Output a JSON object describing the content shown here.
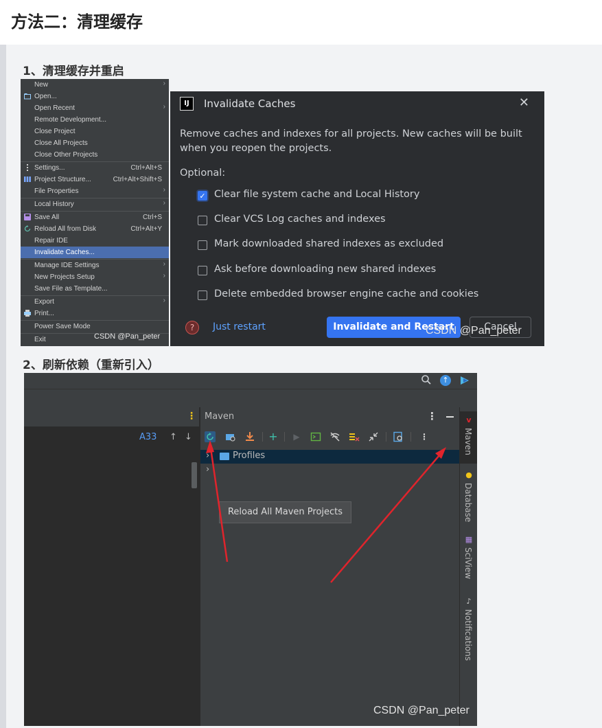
{
  "heading": "方法二：清理缓存",
  "steps": {
    "step1": "1、清理缓存并重启",
    "step2": "2、刷新依赖（重新引入）"
  },
  "file_menu": {
    "items": [
      {
        "label": "New",
        "shortcut": "",
        "submenu": true,
        "icon": ""
      },
      {
        "label": "Open...",
        "shortcut": "",
        "submenu": false,
        "icon": "folder-icon"
      },
      {
        "label": "Open Recent",
        "shortcut": "",
        "submenu": true,
        "icon": ""
      },
      {
        "label": "Remote Development...",
        "shortcut": "",
        "submenu": false,
        "icon": ""
      },
      {
        "label": "Close Project",
        "shortcut": "",
        "submenu": false,
        "icon": ""
      },
      {
        "label": "Close All Projects",
        "shortcut": "",
        "submenu": false,
        "icon": ""
      },
      {
        "label": "Close Other Projects",
        "shortcut": "",
        "submenu": false,
        "icon": ""
      },
      {
        "label": "Settings...",
        "shortcut": "Ctrl+Alt+S",
        "submenu": false,
        "icon": "settings-icon"
      },
      {
        "label": "Project Structure...",
        "shortcut": "Ctrl+Alt+Shift+S",
        "submenu": false,
        "icon": "project-structure-icon"
      },
      {
        "label": "File Properties",
        "shortcut": "",
        "submenu": true,
        "icon": ""
      },
      {
        "label": "Local History",
        "shortcut": "",
        "submenu": true,
        "icon": ""
      },
      {
        "label": "Save All",
        "shortcut": "Ctrl+S",
        "submenu": false,
        "icon": "save-icon"
      },
      {
        "label": "Reload All from Disk",
        "shortcut": "Ctrl+Alt+Y",
        "submenu": false,
        "icon": "reload-icon"
      },
      {
        "label": "Repair IDE",
        "shortcut": "",
        "submenu": false,
        "icon": ""
      },
      {
        "label": "Invalidate Caches...",
        "shortcut": "",
        "submenu": false,
        "icon": "",
        "selected": true
      },
      {
        "label": "Manage IDE Settings",
        "shortcut": "",
        "submenu": true,
        "icon": ""
      },
      {
        "label": "New Projects Setup",
        "shortcut": "",
        "submenu": true,
        "icon": ""
      },
      {
        "label": "Save File as Template...",
        "shortcut": "",
        "submenu": false,
        "icon": ""
      },
      {
        "label": "Export",
        "shortcut": "",
        "submenu": true,
        "icon": ""
      },
      {
        "label": "Print...",
        "shortcut": "",
        "submenu": false,
        "icon": "print-icon"
      },
      {
        "label": "Power Save Mode",
        "shortcut": "",
        "submenu": false,
        "icon": ""
      },
      {
        "label": "Exit",
        "shortcut": "",
        "submenu": false,
        "icon": ""
      }
    ]
  },
  "watermark": "CSDN @Pan_peter",
  "dialog": {
    "title": "Invalidate Caches",
    "logo": "IJ",
    "description": "Remove caches and indexes for all projects. New caches will be built when you reopen the projects.",
    "optional_label": "Optional:",
    "options": [
      {
        "label": "Clear file system cache and Local History",
        "checked": true
      },
      {
        "label": "Clear VCS Log caches and indexes",
        "checked": false
      },
      {
        "label": "Mark downloaded shared indexes as excluded",
        "checked": false
      },
      {
        "label": "Ask before downloading new shared indexes",
        "checked": false
      },
      {
        "label": "Delete embedded browser engine cache and cookies",
        "checked": false
      }
    ],
    "help": "?",
    "just_restart": "Just restart",
    "primary": "Invalidate and Restart",
    "cancel": "Cancel"
  },
  "ide": {
    "problems_count": "33",
    "maven_title": "Maven",
    "tree": {
      "profiles": "Profiles"
    },
    "tooltip": "Reload All Maven Projects",
    "side_tabs": [
      "Maven",
      "Database",
      "SciView",
      "Notifications"
    ]
  },
  "colors": {
    "accent": "#3574f0",
    "menu_selected": "#4b6eaf",
    "annotation_arrow": "#e0242c"
  }
}
